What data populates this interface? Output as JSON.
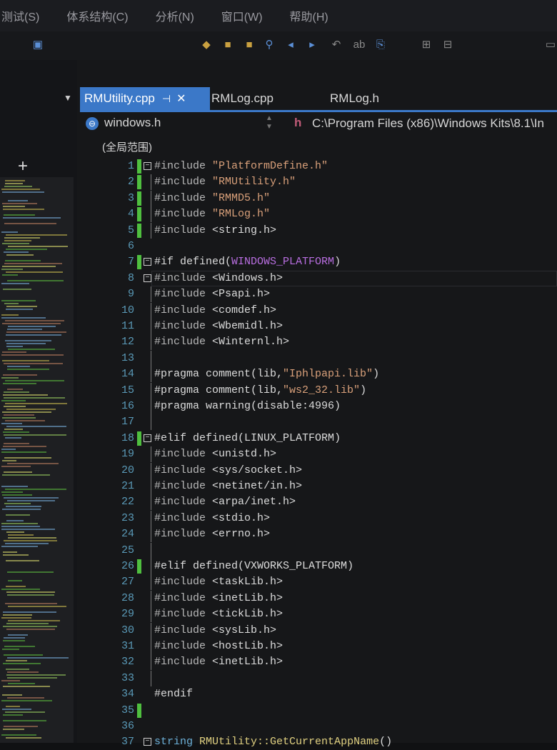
{
  "menubar": {
    "items": [
      "测试(S)",
      "体系结构(C)",
      "分析(N)",
      "窗口(W)",
      "帮助(H)"
    ]
  },
  "tabs": [
    {
      "label": "RMUtility.cpp",
      "active": true,
      "pin": "⊣",
      "close": "✕"
    },
    {
      "label": "RMLog.cpp",
      "active": false
    },
    {
      "label": "RMLog.h",
      "active": false
    }
  ],
  "navbar": {
    "left": "windows.h",
    "path": "C:\\Program Files (x86)\\Windows Kits\\8.1\\In"
  },
  "scope": "(全局范围)",
  "code": [
    {
      "n": "1",
      "text": "#include \"PlatformDefine.h\"",
      "fold": "minus",
      "chg": true
    },
    {
      "n": "2",
      "text": "#include \"RMUtility.h\"",
      "chg": true
    },
    {
      "n": "3",
      "text": "#include \"RMMD5.h\"",
      "chg": true
    },
    {
      "n": "4",
      "text": "#include \"RMLog.h\"",
      "chg": true
    },
    {
      "n": "5",
      "text": "#include <string.h>",
      "chg": true
    },
    {
      "n": "6",
      "text": ""
    },
    {
      "n": "7",
      "text": "#if defined(WINDOWS_PLATFORM)",
      "fold": "minus",
      "chg": true
    },
    {
      "n": "8",
      "text": "#include <Windows.h>",
      "fold": "minus"
    },
    {
      "n": "9",
      "text": "#include <Psapi.h>"
    },
    {
      "n": "10",
      "text": "#include <comdef.h>"
    },
    {
      "n": "11",
      "text": "#include <Wbemidl.h>"
    },
    {
      "n": "12",
      "text": "#include <Winternl.h>"
    },
    {
      "n": "13",
      "text": ""
    },
    {
      "n": "14",
      "text": "#pragma comment(lib,\"Iphlpapi.lib\")"
    },
    {
      "n": "15",
      "text": "#pragma comment(lib,\"ws2_32.lib\")"
    },
    {
      "n": "16",
      "text": "#pragma warning(disable:4996)"
    },
    {
      "n": "17",
      "text": ""
    },
    {
      "n": "18",
      "text": "#elif defined(LINUX_PLATFORM)",
      "fold": "minus",
      "chg": true
    },
    {
      "n": "19",
      "text": "#include <unistd.h>"
    },
    {
      "n": "20",
      "text": "#include <sys/socket.h>"
    },
    {
      "n": "21",
      "text": "#include <netinet/in.h>"
    },
    {
      "n": "22",
      "text": "#include <arpa/inet.h>"
    },
    {
      "n": "23",
      "text": "#include <stdio.h>"
    },
    {
      "n": "24",
      "text": "#include <errno.h>"
    },
    {
      "n": "25",
      "text": ""
    },
    {
      "n": "26",
      "text": "#elif defined(VXWORKS_PLATFORM)",
      "chg": true
    },
    {
      "n": "27",
      "text": "#include <taskLib.h>"
    },
    {
      "n": "28",
      "text": "#include <inetLib.h>"
    },
    {
      "n": "29",
      "text": "#include <tickLib.h>"
    },
    {
      "n": "30",
      "text": "#include <sysLib.h>"
    },
    {
      "n": "31",
      "text": "#include <hostLib.h>"
    },
    {
      "n": "32",
      "text": "#include <inetLib.h>"
    },
    {
      "n": "33",
      "text": ""
    },
    {
      "n": "34",
      "text": "#endif"
    },
    {
      "n": "35",
      "text": "",
      "chg": true
    },
    {
      "n": "36",
      "text": ""
    },
    {
      "n": "37",
      "text": "string RMUtility::GetCurrentAppName()",
      "fold": "minus"
    }
  ],
  "colors": {
    "accent": "#3b78c8",
    "change_bar": "#4fbf3f",
    "line_numbers": "#5a9ab8",
    "string": "#d9a07a",
    "macro": "#b86ee0"
  }
}
